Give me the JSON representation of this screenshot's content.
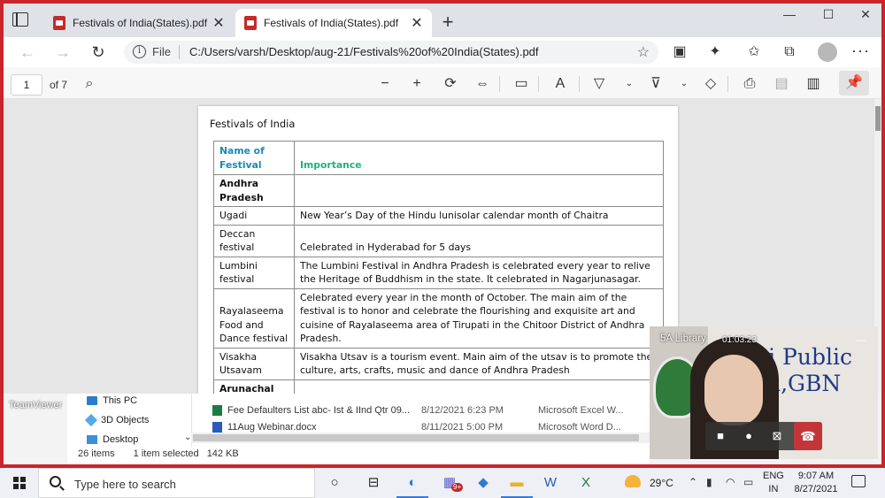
{
  "browser": {
    "tabs": [
      {
        "title": "Festivals of India(States).pdf",
        "active": false
      },
      {
        "title": "Festivals of India(States).pdf",
        "active": true
      }
    ],
    "new_tab": "+",
    "window_controls": {
      "minimize": "—",
      "maximize": "☐",
      "close": "✕"
    },
    "address": {
      "scheme_label": "File",
      "url": "C:/Users/varsh/Desktop/aug-21/Festivals%20of%20India(States).pdf"
    }
  },
  "pdf_toolbar": {
    "page_number": "1",
    "page_count_label": "of 7"
  },
  "document": {
    "title": "Festivals of India",
    "headers": {
      "name": "Name of Festival",
      "importance": "Importance"
    },
    "rows": [
      {
        "type": "state",
        "name": "Andhra Pradesh",
        "importance": ""
      },
      {
        "type": "festival",
        "name": "Ugadi",
        "importance": "New Year’s Day of the Hindu lunisolar calendar month of Chaitra"
      },
      {
        "type": "festival",
        "name": "Deccan festival",
        "importance": "Celebrated in Hyderabad for 5 days"
      },
      {
        "type": "festival",
        "name": "Lumbini festival",
        "importance": "The Lumbini Festival in Andhra Pradesh is celebrated every year to relive the Heritage of Buddhism in the state. It celebrated in Nagarjunasagar."
      },
      {
        "type": "festival",
        "name": "Rayalaseema Food and Dance festival",
        "importance": "Celebrated every year in the month of October. The main aim of the festival is to honor and celebrate the flourishing and exquisite art and cuisine of Rayalaseema area of Tirupati in the Chitoor District of Andhra Pradesh."
      },
      {
        "type": "festival",
        "name": "Visakha Utsavam",
        "importance": "Visakha Utsav is a tourism event. Main aim of the utsav is to promote the culture, arts, crafts, music and dance of Andhra Pradesh"
      },
      {
        "type": "state",
        "name": "Arunachal",
        "importance": ""
      }
    ]
  },
  "explorer": {
    "nav": [
      "This PC",
      "3D Objects",
      "Desktop"
    ],
    "files": [
      {
        "name": "Fee Defaulters List abc- Ist & IInd Qtr 09...",
        "date": "8/12/2021 6:23 PM",
        "type": "Microsoft Excel W...",
        "icon": "excel-icon"
      },
      {
        "name": "11Aug Webinar.docx",
        "date": "8/11/2021 5:00 PM",
        "type": "Microsoft Word D...",
        "icon": "word-icon"
      }
    ],
    "status": {
      "count": "26 items",
      "selected": "1 item selected",
      "size": "142 KB"
    }
  },
  "desktop": {
    "teamviewer_label": "TeamViewer"
  },
  "video_call": {
    "participant": "5A Library",
    "duration": "01:03:23",
    "background_text_line1": "lhi Public",
    "background_text_line2": "ool,GBN"
  },
  "taskbar": {
    "search_placeholder": "Type here to search",
    "teams_badge": "9+",
    "temperature": "29°C",
    "language_line1": "ENG",
    "language_line2": "IN",
    "time": "9:07 AM",
    "date": "8/27/2021"
  },
  "colors": {
    "frame": "#c9252b",
    "header_name": "#1e88b8",
    "header_importance": "#20b37c",
    "end_call": "#c2363a"
  }
}
